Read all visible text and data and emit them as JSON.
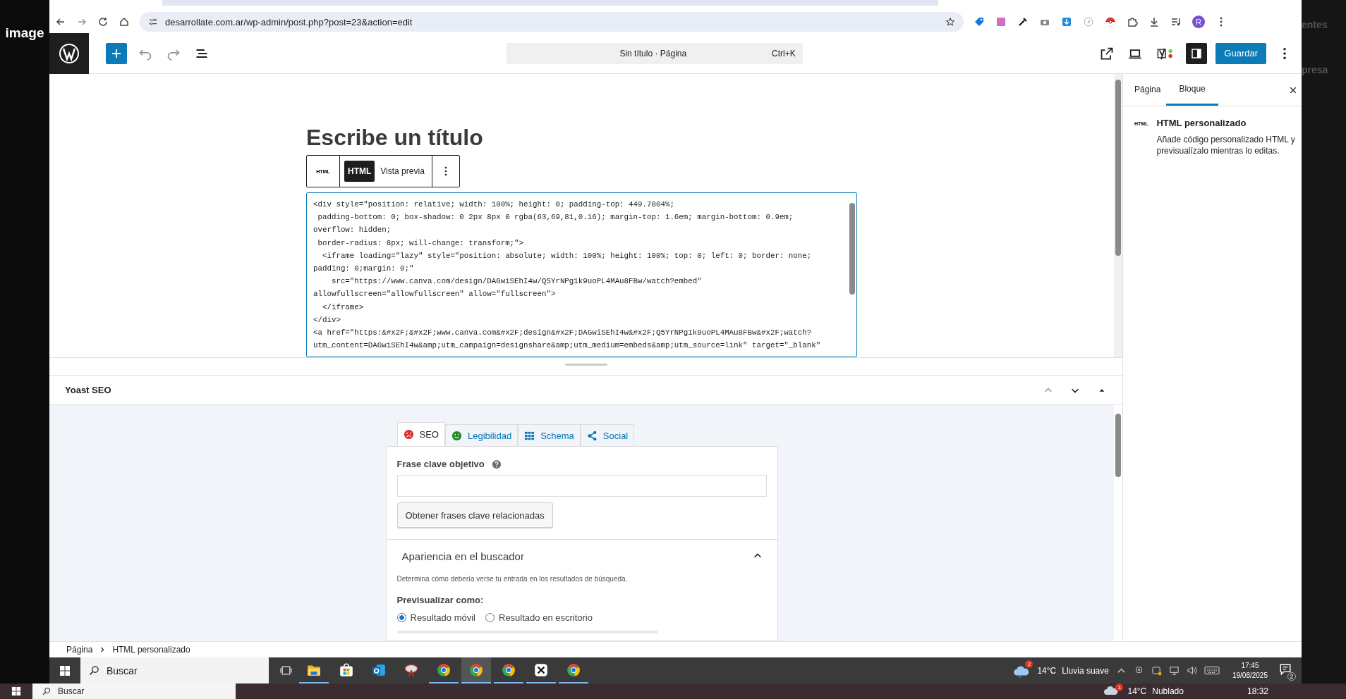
{
  "background": {
    "left_label": "image",
    "right_fragments": [
      "entes",
      "presa"
    ]
  },
  "browser": {
    "url": "desarrollate.com.ar/wp-admin/post.php?post=23&action=edit",
    "profile_initial": "R"
  },
  "editor_toolbar": {
    "command_bar": "Sin título · Página",
    "shortcut": "Ctrl+K",
    "sidebar_toggle": {
      "pressed": true
    },
    "save_button": "Guardar"
  },
  "editor": {
    "title_placeholder": "Escribe un título",
    "block_toolbar": {
      "block_icon_label": "HTML",
      "modes": [
        {
          "label": "HTML",
          "selected": true
        },
        {
          "label": "Vista previa",
          "selected": false
        }
      ]
    },
    "code_lines": [
      "<div style=\"position: relative; width: 100%; height: 0; padding-top: 449.7804%;",
      " padding-bottom: 0; box-shadow: 0 2px 8px 0 rgba(63,69,81,0.16); margin-top: 1.6em; margin-bottom: 0.9em;",
      "overflow: hidden;",
      " border-radius: 8px; will-change: transform;\">",
      "  <iframe loading=\"lazy\" style=\"position: absolute; width: 100%; height: 100%; top: 0; left: 0; border: none;",
      "padding: 0;margin: 0;\"",
      "    src=\"https://www.canva.com/design/DAGwiSEhI4w/Q5YrNPg1k9uoPL4MAu8FBw/watch?embed\"",
      "allowfullscreen=\"allowfullscreen\" allow=\"fullscreen\">",
      "  </iframe>",
      "</div>",
      "<a href=\"https:&#x2F;&#x2F;www.canva.com&#x2F;design&#x2F;DAGwiSEhI4w&#x2F;Q5YrNPg1k9uoPL4MAu8FBw&#x2F;watch?",
      "utm_content=DAGwiSEhI4w&amp;utm_campaign=designshare&amp;utm_medium=embeds&amp;utm_source=link\" target=\"_blank\""
    ]
  },
  "sidebar": {
    "tabs": [
      {
        "label": "Página",
        "selected": false
      },
      {
        "label": "Bloque",
        "selected": true
      }
    ],
    "block": {
      "icon_label": "HTML",
      "title": "HTML personalizado",
      "description": "Añade código personalizado HTML y previsualízalo mientras lo editas."
    }
  },
  "yoast": {
    "title": "Yoast SEO",
    "tabs": [
      {
        "label": "SEO",
        "kind": "seo",
        "selected": true
      },
      {
        "label": "Legibilidad",
        "kind": "readability",
        "selected": false
      },
      {
        "label": "Schema",
        "kind": "schema",
        "selected": false
      },
      {
        "label": "Social",
        "kind": "social",
        "selected": false
      }
    ],
    "focus_keyphrase_label": "Frase clave objetivo",
    "related_button": "Obtener frases clave relacionadas",
    "appearance": {
      "title": "Apariencia en el buscador",
      "expanded": true,
      "description": "Determina cómo debería verse tu entrada en los resultados de búsqueda.",
      "preview_label": "Previsualizar como:",
      "options": [
        {
          "label": "Resultado móvil",
          "selected": true
        },
        {
          "label": "Resultado en escritorio",
          "selected": false
        }
      ]
    }
  },
  "breadcrumb": [
    "Página",
    "HTML personalizado"
  ],
  "taskbar": {
    "search_placeholder": "Buscar",
    "apps": [
      {
        "kind": "folder",
        "running": true,
        "selected": false
      },
      {
        "kind": "store",
        "running": false,
        "selected": false
      },
      {
        "kind": "mail",
        "running": false,
        "selected": false
      },
      {
        "kind": "paint",
        "running": false,
        "selected": false
      },
      {
        "kind": "browser",
        "running": true,
        "selected": false
      },
      {
        "kind": "browser",
        "running": true,
        "selected": true
      },
      {
        "kind": "browser",
        "running": true,
        "selected": false
      },
      {
        "kind": "editor",
        "running": true,
        "selected": false
      },
      {
        "kind": "browser",
        "running": true,
        "selected": false
      }
    ],
    "weather": {
      "badge": "2",
      "temperature": "14°C",
      "condition": "Lluvia suave"
    },
    "time": "17:45",
    "date": "19/08/2025",
    "notifications": "2"
  },
  "outer_taskbar": {
    "search_placeholder": "Buscar",
    "weather": {
      "badge": "1",
      "temperature": "14°C",
      "condition": "Nublado"
    },
    "time": "18:32"
  }
}
